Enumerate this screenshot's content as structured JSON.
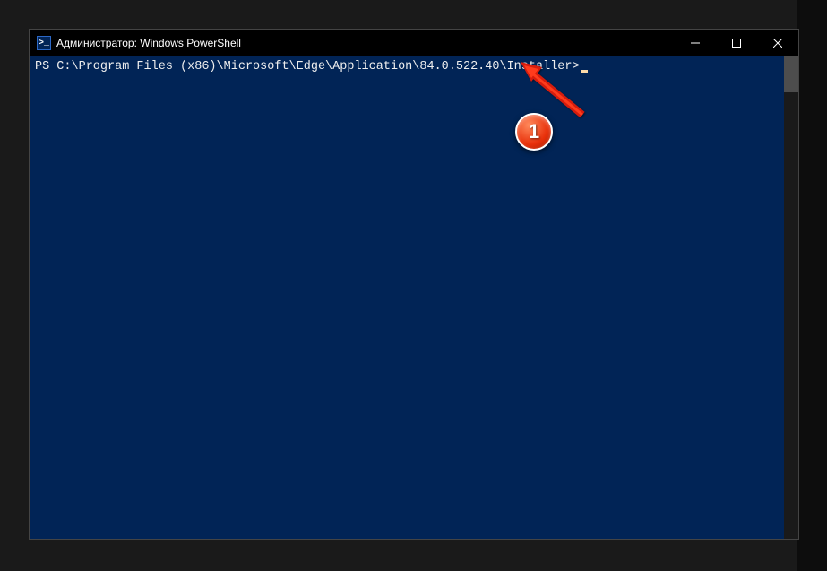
{
  "window": {
    "title": "Администратор: Windows PowerShell",
    "icon_label": ">_"
  },
  "controls": {
    "minimize": "─",
    "maximize": "▢",
    "close": "✕"
  },
  "terminal": {
    "prompt": "PS C:\\Program Files (x86)\\Microsoft\\Edge\\Application\\84.0.522.40\\Installer>"
  },
  "annotation": {
    "badge_number": "1"
  }
}
